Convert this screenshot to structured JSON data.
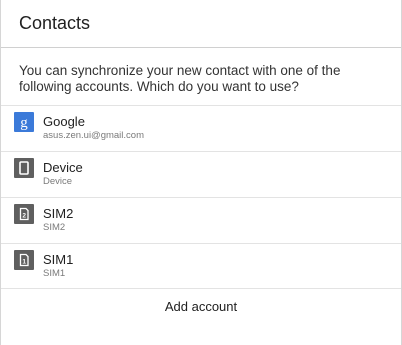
{
  "dialog": {
    "title": "Contacts",
    "message": "You can synchronize your new contact with one of the following accounts. Which do you want to use?"
  },
  "accounts": [
    {
      "name": "Google",
      "detail": "asus.zen.ui@gmail.com",
      "icon": "google-icon"
    },
    {
      "name": "Device",
      "detail": "Device",
      "icon": "device-icon"
    },
    {
      "name": "SIM2",
      "detail": "SIM2",
      "icon": "sim2-icon"
    },
    {
      "name": "SIM1",
      "detail": "SIM1",
      "icon": "sim1-icon"
    }
  ],
  "actions": {
    "add_account_label": "Add account"
  },
  "colors": {
    "google_blue": "#3b7ad9",
    "device_gray": "#5f5f5f"
  }
}
